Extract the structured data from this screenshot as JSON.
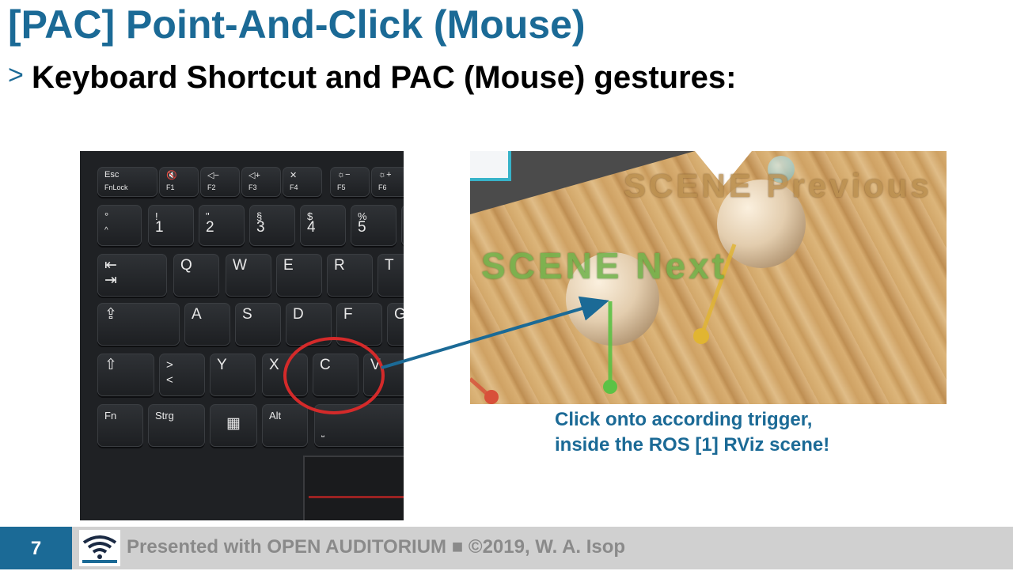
{
  "slide": {
    "title": "[PAC] Point-And-Click (Mouse)",
    "bullet_marker": ">",
    "bullet_text": "Keyboard Shortcut and PAC (Mouse) gestures:"
  },
  "keyboard": {
    "keys": {
      "esc": "Esc",
      "fnlock": "FnLock",
      "f1": "F1",
      "f2": "F2",
      "f3": "F3",
      "f4": "F4",
      "f5": "F5",
      "f6": "F6",
      "k1": "1",
      "k2": "2",
      "k3": "3",
      "k4": "4",
      "k5": "5",
      "k1_top": "!",
      "k2_top": "\"",
      "k3_top": "§",
      "k4_top": "$",
      "k5_top": "%",
      "k0_top": "°",
      "k0_bot": "^",
      "q": "Q",
      "w": "W",
      "e": "E",
      "r": "R",
      "t": "T",
      "a": "A",
      "s": "S",
      "d": "D",
      "f": "F",
      "g": "G",
      "y": "Y",
      "x": "X",
      "c": "C",
      "v": "V",
      "lt": ">\n<",
      "fn": "Fn",
      "strg": "Strg",
      "alt": "Alt"
    }
  },
  "scene": {
    "label_next": "SCENE Next",
    "label_previous": "SCENE Previous"
  },
  "caption": {
    "line1": "Click onto according trigger,",
    "line2": "inside the ROS [1] RViz scene!"
  },
  "footer": {
    "page_number": "7",
    "text": "Presented with OPEN AUDITORIUM ■ ©2019, W. A. Isop",
    "logo_text": "OPEN AUDITORIUM"
  },
  "colors": {
    "accent": "#1b6a96",
    "highlight_circle": "#d42a2a",
    "footer_bg": "#d0d0d0"
  },
  "icons": [
    "wifi-logo-icon",
    "windows-icon",
    "tab-icon",
    "shift-icon",
    "capslock-icon",
    "mute-icon",
    "volume-down-icon",
    "volume-up-icon",
    "mic-mute-icon",
    "brightness-down-icon",
    "brightness-up-icon",
    "arrow-icon"
  ]
}
